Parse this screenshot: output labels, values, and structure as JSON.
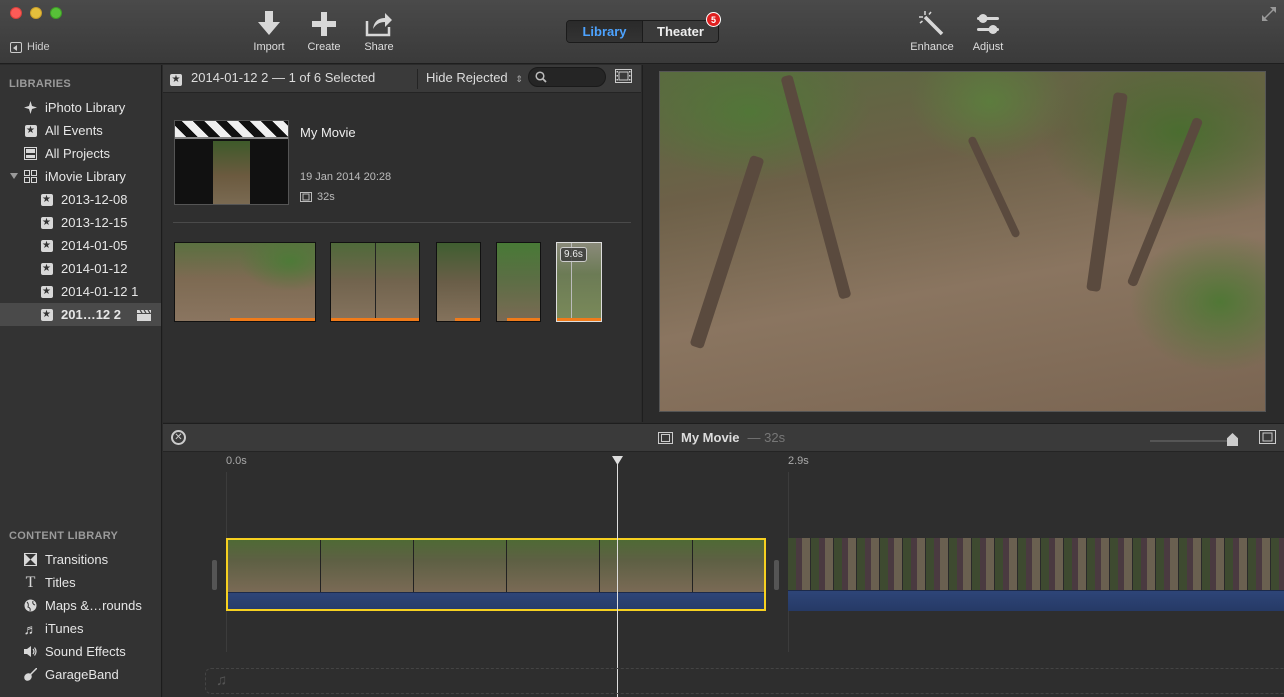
{
  "toolbar": {
    "hide_label": "Hide",
    "import_label": "Import",
    "create_label": "Create",
    "share_label": "Share",
    "library_tab": "Library",
    "theater_tab": "Theater",
    "theater_badge": "5",
    "enhance_label": "Enhance",
    "adjust_label": "Adjust"
  },
  "sidebar": {
    "libraries_header": "LIBRARIES",
    "items": [
      {
        "label": "iPhoto Library",
        "icon": "iphoto-icon"
      },
      {
        "label": "All Events",
        "icon": "star-icon"
      },
      {
        "label": "All Projects",
        "icon": "projects-icon"
      },
      {
        "label": "iMovie Library",
        "icon": "library-grid-icon"
      },
      {
        "label": "2013-12-08",
        "icon": "star-icon"
      },
      {
        "label": "2013-12-15",
        "icon": "star-icon"
      },
      {
        "label": "2014-01-05",
        "icon": "star-icon"
      },
      {
        "label": "2014-01-12",
        "icon": "star-icon"
      },
      {
        "label": "2014-01-12 1",
        "icon": "star-icon"
      },
      {
        "label": "201…12 2",
        "icon": "star-icon"
      }
    ],
    "content_header": "CONTENT LIBRARY",
    "content_items": [
      {
        "label": "Transitions",
        "icon": "transitions-icon"
      },
      {
        "label": "Titles",
        "icon": "titles-icon"
      },
      {
        "label": "Maps &…rounds",
        "icon": "globe-icon"
      },
      {
        "label": "iTunes",
        "icon": "music-note-icon"
      },
      {
        "label": "Sound Effects",
        "icon": "speaker-icon"
      },
      {
        "label": "GarageBand",
        "icon": "guitar-icon"
      }
    ]
  },
  "browser": {
    "event_title": "2014-01-12 2 — 1 of 6 Selected",
    "filter_label": "Hide Rejected",
    "search_placeholder": "",
    "project": {
      "name": "My Movie",
      "date": "19 Jan 2014 20:28",
      "duration": "32s"
    },
    "selected_clip_duration": "9.6s"
  },
  "timeline": {
    "title": "My Movie",
    "duration": "— 32s",
    "tick_start": "0.0s",
    "tick_mid": "2.9s"
  },
  "colors": {
    "accent": "#4da3ff",
    "selection": "#f6d020",
    "favorite_bar": "#f07b1a",
    "badge": "#e02020"
  }
}
